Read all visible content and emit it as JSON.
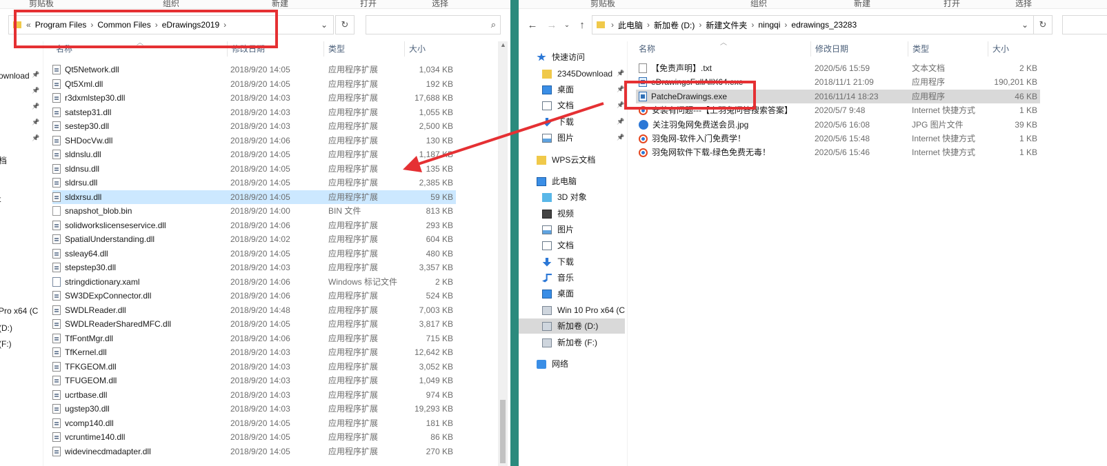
{
  "left": {
    "ribbon_groups": [
      "剪贴板",
      "组织",
      "新建",
      "打开",
      "选择"
    ],
    "breadcrumb": [
      "Program Files",
      "Common Files",
      "eDrawings2019"
    ],
    "breadcrumb_overflow": "«",
    "columns": {
      "name": "名称",
      "date": "修改日期",
      "type": "类型",
      "size": "大小"
    },
    "nav_partial": [
      {
        "label": "ownload",
        "pinned": true
      },
      {
        "label": "",
        "pinned": true
      },
      {
        "label": "",
        "pinned": true
      },
      {
        "label": "",
        "pinned": true
      },
      {
        "label": "",
        "pinned": true
      },
      {
        "label": "档",
        "pinned": false
      },
      {
        "label": "",
        "pinned": false
      },
      {
        "label": "t",
        "pinned": false
      },
      {
        "label": "Pro x64 (C",
        "pinned": false
      },
      {
        "label": "(D:)",
        "pinned": false
      },
      {
        "label": "(F:)",
        "pinned": false
      }
    ],
    "files": [
      {
        "name": "Qt5Network.dll",
        "date": "2018/9/20 14:05",
        "type": "应用程序扩展",
        "size": "1,034 KB",
        "icon": "dll"
      },
      {
        "name": "Qt5Xml.dll",
        "date": "2018/9/20 14:05",
        "type": "应用程序扩展",
        "size": "192 KB",
        "icon": "dll"
      },
      {
        "name": "r3dxmlstep30.dll",
        "date": "2018/9/20 14:03",
        "type": "应用程序扩展",
        "size": "17,688 KB",
        "icon": "dll"
      },
      {
        "name": "satstep31.dll",
        "date": "2018/9/20 14:03",
        "type": "应用程序扩展",
        "size": "1,055 KB",
        "icon": "dll"
      },
      {
        "name": "sestep30.dll",
        "date": "2018/9/20 14:03",
        "type": "应用程序扩展",
        "size": "2,500 KB",
        "icon": "dll"
      },
      {
        "name": "SHDocVw.dll",
        "date": "2018/9/20 14:06",
        "type": "应用程序扩展",
        "size": "130 KB",
        "icon": "dll"
      },
      {
        "name": "sldnslu.dll",
        "date": "2018/9/20 14:05",
        "type": "应用程序扩展",
        "size": "1,187 KB",
        "icon": "dll"
      },
      {
        "name": "sldnsu.dll",
        "date": "2018/9/20 14:05",
        "type": "应用程序扩展",
        "size": "135 KB",
        "icon": "dll"
      },
      {
        "name": "sldrsu.dll",
        "date": "2018/9/20 14:05",
        "type": "应用程序扩展",
        "size": "2,385 KB",
        "icon": "dll"
      },
      {
        "name": "sldxrsu.dll",
        "date": "2018/9/20 14:05",
        "type": "应用程序扩展",
        "size": "59 KB",
        "icon": "dll",
        "selected": true
      },
      {
        "name": "snapshot_blob.bin",
        "date": "2018/9/20 14:00",
        "type": "BIN 文件",
        "size": "813 KB",
        "icon": "bin"
      },
      {
        "name": "solidworkslicenseservice.dll",
        "date": "2018/9/20 14:06",
        "type": "应用程序扩展",
        "size": "293 KB",
        "icon": "dll"
      },
      {
        "name": "SpatialUnderstanding.dll",
        "date": "2018/9/20 14:02",
        "type": "应用程序扩展",
        "size": "604 KB",
        "icon": "dll"
      },
      {
        "name": "ssleay64.dll",
        "date": "2018/9/20 14:05",
        "type": "应用程序扩展",
        "size": "480 KB",
        "icon": "dll"
      },
      {
        "name": "stepstep30.dll",
        "date": "2018/9/20 14:03",
        "type": "应用程序扩展",
        "size": "3,357 KB",
        "icon": "dll"
      },
      {
        "name": "stringdictionary.xaml",
        "date": "2018/9/20 14:06",
        "type": "Windows 标记文件",
        "size": "2 KB",
        "icon": "xaml"
      },
      {
        "name": "SW3DExpConnector.dll",
        "date": "2018/9/20 14:06",
        "type": "应用程序扩展",
        "size": "524 KB",
        "icon": "dll"
      },
      {
        "name": "SWDLReader.dll",
        "date": "2018/9/20 14:48",
        "type": "应用程序扩展",
        "size": "7,003 KB",
        "icon": "dll"
      },
      {
        "name": "SWDLReaderSharedMFC.dll",
        "date": "2018/9/20 14:05",
        "type": "应用程序扩展",
        "size": "3,817 KB",
        "icon": "dll"
      },
      {
        "name": "TfFontMgr.dll",
        "date": "2018/9/20 14:06",
        "type": "应用程序扩展",
        "size": "715 KB",
        "icon": "dll"
      },
      {
        "name": "TfKernel.dll",
        "date": "2018/9/20 14:03",
        "type": "应用程序扩展",
        "size": "12,642 KB",
        "icon": "dll"
      },
      {
        "name": "TFKGEOM.dll",
        "date": "2018/9/20 14:03",
        "type": "应用程序扩展",
        "size": "3,052 KB",
        "icon": "dll"
      },
      {
        "name": "TFUGEOM.dll",
        "date": "2018/9/20 14:03",
        "type": "应用程序扩展",
        "size": "1,049 KB",
        "icon": "dll"
      },
      {
        "name": "ucrtbase.dll",
        "date": "2018/9/20 14:03",
        "type": "应用程序扩展",
        "size": "974 KB",
        "icon": "dll"
      },
      {
        "name": "ugstep30.dll",
        "date": "2018/9/20 14:03",
        "type": "应用程序扩展",
        "size": "19,293 KB",
        "icon": "dll"
      },
      {
        "name": "vcomp140.dll",
        "date": "2018/9/20 14:05",
        "type": "应用程序扩展",
        "size": "181 KB",
        "icon": "dll"
      },
      {
        "name": "vcruntime140.dll",
        "date": "2018/9/20 14:05",
        "type": "应用程序扩展",
        "size": "86 KB",
        "icon": "dll"
      },
      {
        "name": "widevinecdmadapter.dll",
        "date": "2018/9/20 14:05",
        "type": "应用程序扩展",
        "size": "270 KB",
        "icon": "dll"
      }
    ]
  },
  "right": {
    "ribbon_groups": [
      "剪贴板",
      "组织",
      "新建",
      "打开",
      "选择"
    ],
    "breadcrumb": [
      "此电脑",
      "新加卷 (D:)",
      "新建文件夹",
      "ningqi",
      "edrawings_23283"
    ],
    "columns": {
      "name": "名称",
      "date": "修改日期",
      "type": "类型",
      "size": "大小"
    },
    "nav": [
      {
        "label": "快速访问",
        "icon": "star",
        "level": 0,
        "pinned": false
      },
      {
        "label": "2345Download",
        "icon": "folder",
        "level": 1,
        "pinned": true
      },
      {
        "label": "桌面",
        "icon": "desktop",
        "level": 1,
        "pinned": true
      },
      {
        "label": "文档",
        "icon": "doc",
        "level": 1,
        "pinned": true
      },
      {
        "label": "下载",
        "icon": "download",
        "level": 1,
        "pinned": true
      },
      {
        "label": "图片",
        "icon": "picture",
        "level": 1,
        "pinned": true
      },
      {
        "label": "WPS云文档",
        "icon": "folder",
        "level": 0,
        "pinned": false
      },
      {
        "label": "此电脑",
        "icon": "pc",
        "level": 0,
        "pinned": false
      },
      {
        "label": "3D 对象",
        "icon": "cube",
        "level": 1,
        "pinned": false
      },
      {
        "label": "视频",
        "icon": "video",
        "level": 1,
        "pinned": false
      },
      {
        "label": "图片",
        "icon": "picture",
        "level": 1,
        "pinned": false
      },
      {
        "label": "文档",
        "icon": "doc",
        "level": 1,
        "pinned": false
      },
      {
        "label": "下载",
        "icon": "download",
        "level": 1,
        "pinned": false
      },
      {
        "label": "音乐",
        "icon": "music",
        "level": 1,
        "pinned": false
      },
      {
        "label": "桌面",
        "icon": "desktop",
        "level": 1,
        "pinned": false
      },
      {
        "label": "Win 10 Pro x64 (C",
        "icon": "osdrive",
        "level": 1,
        "pinned": false
      },
      {
        "label": "新加卷 (D:)",
        "icon": "drive",
        "level": 1,
        "pinned": false,
        "selected": true
      },
      {
        "label": "新加卷 (F:)",
        "icon": "drive",
        "level": 1,
        "pinned": false
      },
      {
        "label": "网络",
        "icon": "network",
        "level": 0,
        "pinned": false
      }
    ],
    "files": [
      {
        "name": "【免责声明】.txt",
        "date": "2020/5/6 15:59",
        "type": "文本文档",
        "size": "2 KB",
        "icon": "txt"
      },
      {
        "name": "eDrawingsFullAllX64.exe",
        "date": "2018/11/1 21:09",
        "type": "应用程序",
        "size": "190,201 KB",
        "icon": "exe"
      },
      {
        "name": "PatcheDrawings.exe",
        "date": "2016/11/14 18:23",
        "type": "应用程序",
        "size": "46 KB",
        "icon": "exe",
        "highlight": true
      },
      {
        "name": "安装有问题---【上羽兔问答搜索答案】",
        "date": "2020/5/7 9:48",
        "type": "Internet 快捷方式",
        "size": "1 KB",
        "icon": "url"
      },
      {
        "name": "关注羽兔网免费送会员.jpg",
        "date": "2020/5/6 16:08",
        "type": "JPG 图片文件",
        "size": "39 KB",
        "icon": "jpg"
      },
      {
        "name": "羽兔网-软件入门免费学！",
        "date": "2020/5/6 15:48",
        "type": "Internet 快捷方式",
        "size": "1 KB",
        "icon": "url"
      },
      {
        "name": "羽兔网软件下载-绿色免费无毒！",
        "date": "2020/5/6 15:46",
        "type": "Internet 快捷方式",
        "size": "1 KB",
        "icon": "url"
      }
    ]
  },
  "annotation_color": "#e53033",
  "divider_color": "#2b8a7d"
}
